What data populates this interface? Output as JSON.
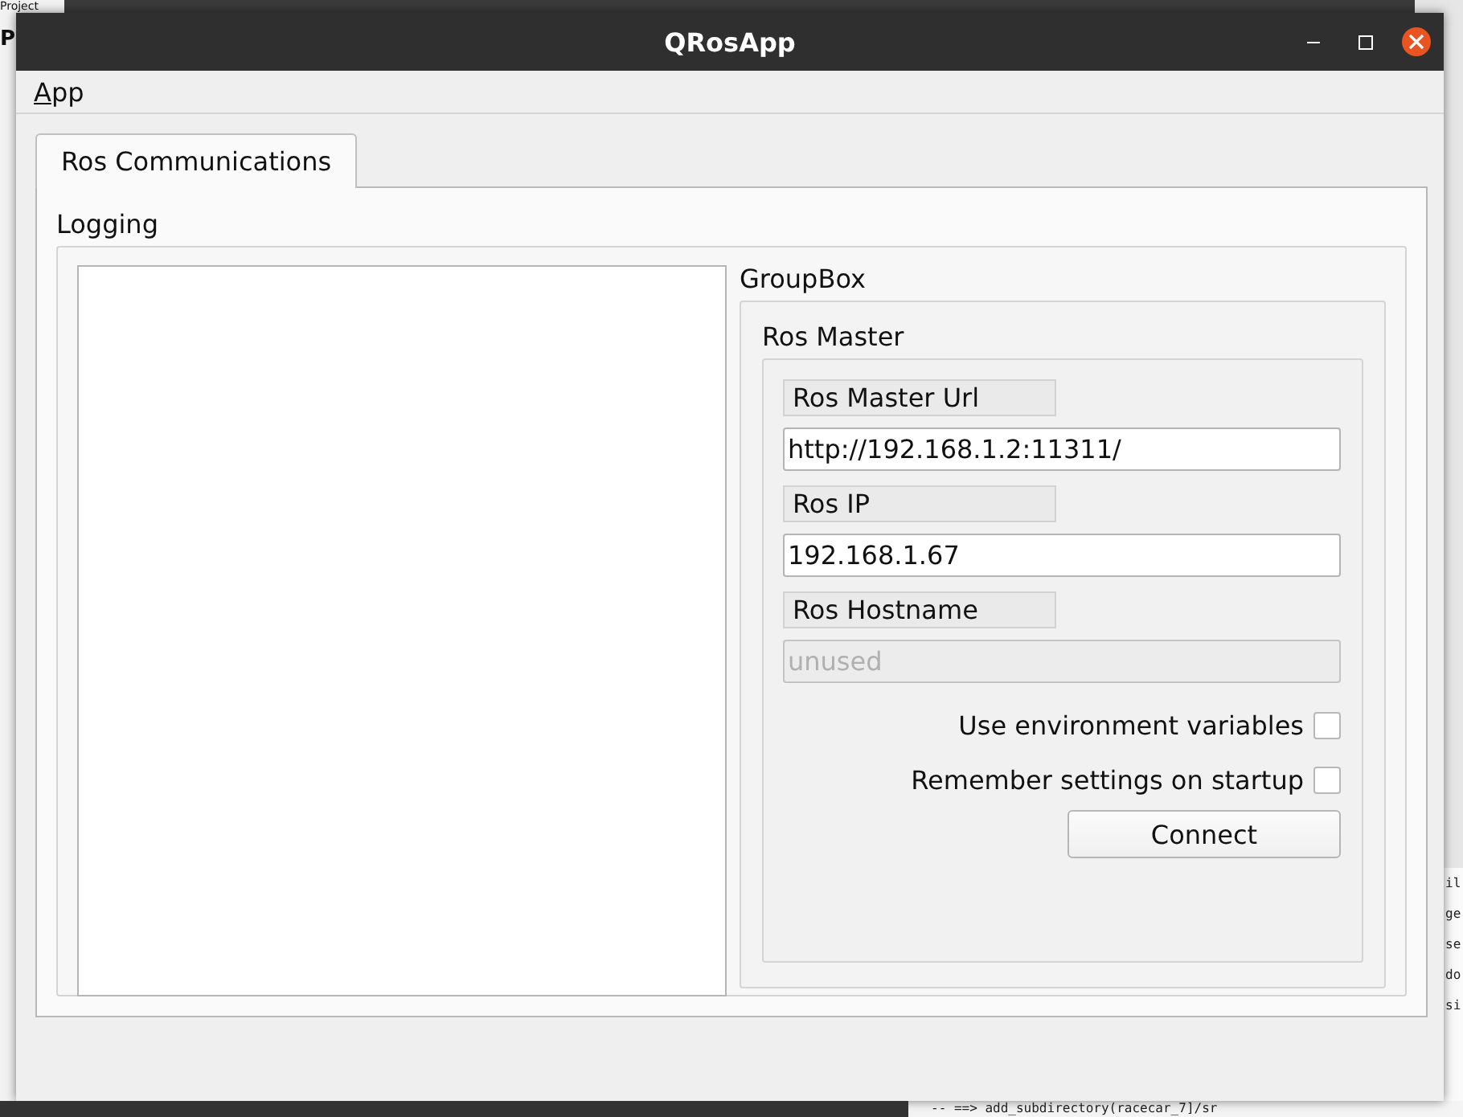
{
  "background": {
    "project_window": {
      "title": "Project",
      "heading": "P"
    },
    "editor": {
      "lines": [
        "il",
        "ge",
        "se",
        "do",
        "si"
      ]
    },
    "terminal": {
      "line": "-- ==> add_subdirectory(racecar_7]/sr"
    }
  },
  "window": {
    "title": "QRosApp"
  },
  "menu": [
    {
      "label": "App"
    }
  ],
  "tabs": [
    {
      "label": "Ros Communications",
      "selected": true
    }
  ],
  "logging": {
    "title": "Logging"
  },
  "groupbox": {
    "title": "GroupBox",
    "ros_master": {
      "title": "Ros Master",
      "fields": [
        {
          "label": "Ros Master Url",
          "value": "http://192.168.1.2:11311/",
          "disabled": false
        },
        {
          "label": "Ros IP",
          "value": "192.168.1.67",
          "disabled": false
        },
        {
          "label": "Ros Hostname",
          "placeholder": "unused",
          "disabled": true
        }
      ],
      "checkboxes": [
        {
          "label": "Use environment variables",
          "checked": false
        },
        {
          "label": "Remember settings on startup",
          "checked": false
        }
      ],
      "button": "Connect"
    }
  }
}
